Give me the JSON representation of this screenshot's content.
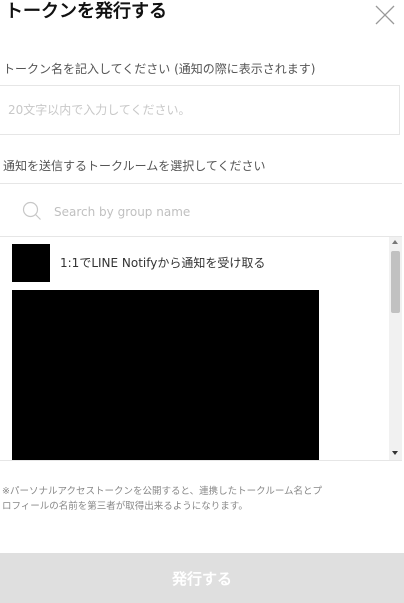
{
  "dialog": {
    "title": "トークンを発行する"
  },
  "token_name": {
    "label": "トークン名を記入してください (通知の際に表示されます)",
    "placeholder": "20文字以内で入力してください。",
    "value": ""
  },
  "room_select": {
    "label": "通知を送信するトークルームを選択してください",
    "search_placeholder": "Search by group name",
    "items": [
      {
        "name": "1:1でLINE Notifyから通知を受け取る"
      }
    ]
  },
  "note": {
    "line1": "※パーソナルアクセストークンを公開すると、連携したトークルーム名とプ",
    "line2": "ロフィールの名前を第三者が取得出来るようになります。"
  },
  "submit": {
    "label": "発行する"
  },
  "colors": {
    "disabled_button": "#dfdfdf",
    "border": "#e6e6e6",
    "muted_text": "#888888"
  }
}
